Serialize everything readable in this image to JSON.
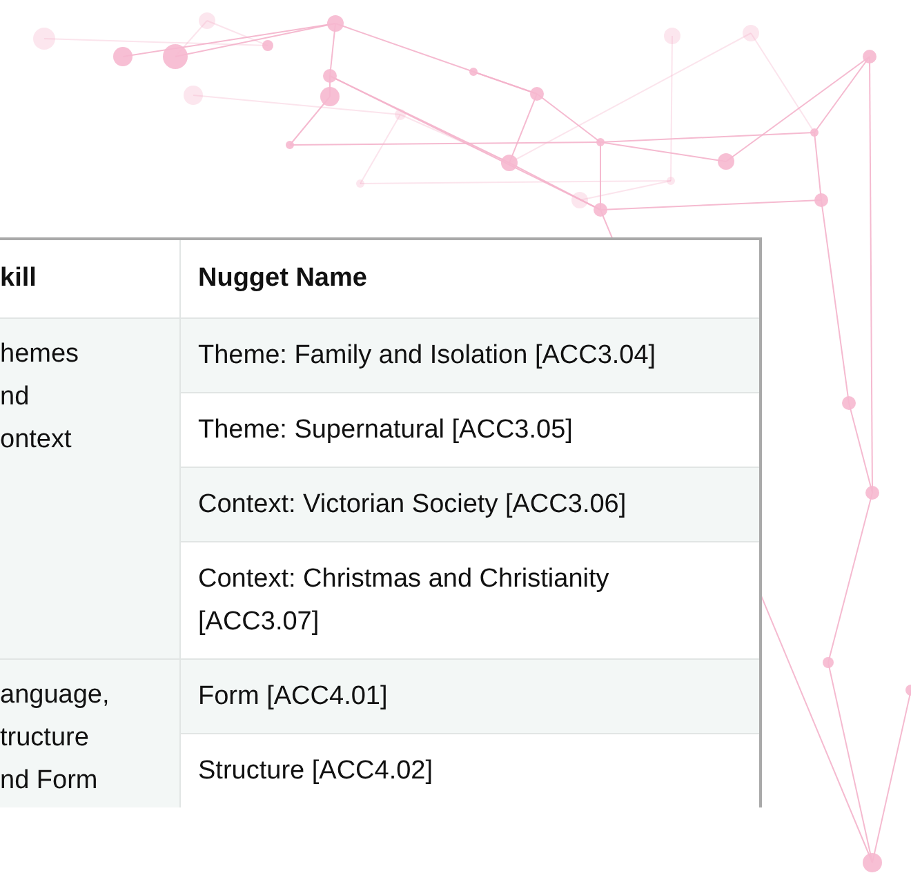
{
  "table": {
    "columns": [
      "kill",
      "Nugget Name"
    ],
    "groups": [
      {
        "skill_lines": [
          "hemes",
          "nd",
          "ontext"
        ],
        "nuggets": [
          "Theme: Family and Isolation [ACC3.04]",
          "Theme: Supernatural [ACC3.05]",
          "Context: Victorian Society [ACC3.06]",
          "Context: Christmas and Christianity [ACC3.07]"
        ]
      },
      {
        "skill_lines": [
          "anguage,",
          "tructure",
          "nd Form"
        ],
        "nuggets": [
          "Form [ACC4.01]",
          "Structure [ACC4.02]"
        ]
      }
    ]
  }
}
